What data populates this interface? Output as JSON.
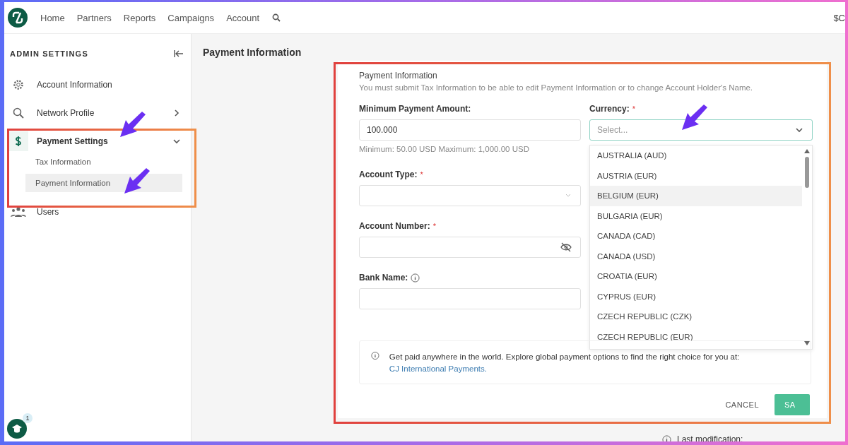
{
  "nav": {
    "links": [
      {
        "label": "Home"
      },
      {
        "label": "Partners"
      },
      {
        "label": "Reports"
      },
      {
        "label": "Campaigns"
      },
      {
        "label": "Account"
      }
    ],
    "account_text": "$C"
  },
  "sidebar": {
    "title": "ADMIN SETTINGS",
    "items": [
      {
        "label": "Account Information",
        "kind": "link"
      },
      {
        "label": "Network Profile",
        "kind": "group",
        "expanded": false
      },
      {
        "label": "Payment Settings",
        "kind": "group",
        "expanded": true,
        "children": [
          {
            "label": "Tax Information",
            "selected": false
          },
          {
            "label": "Payment Information",
            "selected": true
          }
        ]
      },
      {
        "label": "Users",
        "kind": "link"
      }
    ],
    "help_badge": "1"
  },
  "page_title": "Payment Information",
  "form": {
    "heading": "Payment Information",
    "notice": "You must submit Tax Information to be able to edit Payment Information or to change Account Holder's Name.",
    "left_fields": [
      {
        "label": "Minimum Payment Amount:",
        "kind": "input",
        "value": "100.000",
        "hint": "Minimum: 50.00 USD Maximum: 1,000.00 USD"
      },
      {
        "label": "Account Type:",
        "kind": "select",
        "required_mark": "*"
      },
      {
        "label": "Account Number:",
        "kind": "password",
        "required_mark": "*"
      },
      {
        "label": "Bank Name:",
        "kind": "info-input"
      }
    ],
    "currency": {
      "label": "Currency:",
      "required_mark": "*",
      "placeholder": "Select...",
      "open": true,
      "options": [
        {
          "label": "AUSTRALIA (AUD)",
          "highlighted": false
        },
        {
          "label": "AUSTRIA (EUR)",
          "highlighted": false
        },
        {
          "label": "BELGIUM (EUR)",
          "highlighted": true
        },
        {
          "label": "BULGARIA (EUR)",
          "highlighted": false
        },
        {
          "label": "CANADA (CAD)",
          "highlighted": false
        },
        {
          "label": "CANADA (USD)",
          "highlighted": false
        },
        {
          "label": "CROATIA (EUR)",
          "highlighted": false
        },
        {
          "label": "CYPRUS (EUR)",
          "highlighted": false
        },
        {
          "label": "CZECH REPUBLIC (CZK)",
          "highlighted": false
        },
        {
          "label": "CZECH REPUBLIC (EUR)",
          "highlighted": false
        }
      ]
    },
    "info": {
      "text": "Get paid anywhere in the world. Explore global payment options to find the right choice for you at:",
      "link": "CJ International Payments."
    },
    "buttons": [
      {
        "label": "CANCEL",
        "kind": "text"
      },
      {
        "label": "SA",
        "kind": "primary"
      }
    ]
  },
  "footer_note": "Last modification:"
}
